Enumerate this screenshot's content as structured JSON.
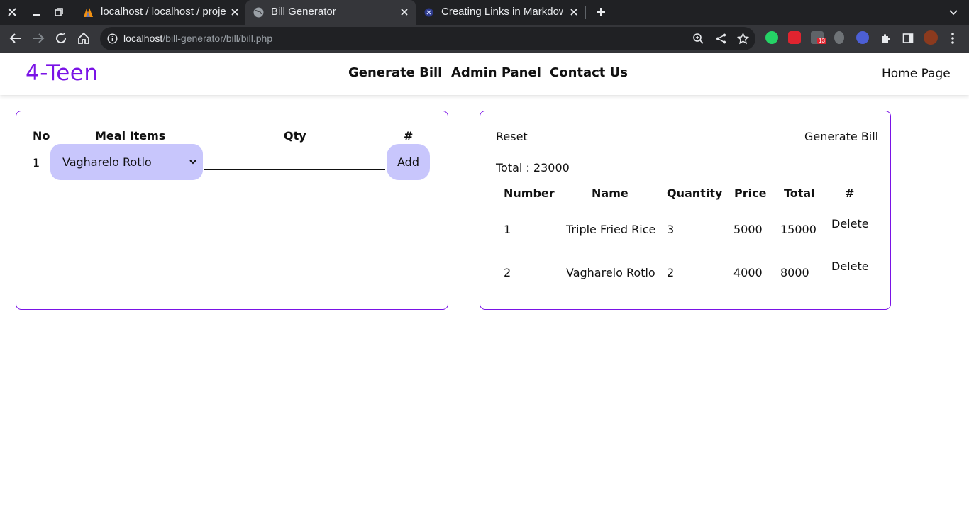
{
  "browser": {
    "tabs": [
      {
        "title": "localhost / localhost / proje",
        "active": false
      },
      {
        "title": "Bill Generator",
        "active": true
      },
      {
        "title": "Creating Links in Markdown",
        "active": false
      }
    ],
    "url": {
      "host": "localhost",
      "path": "/bill-generator/bill/bill.php"
    },
    "extension_badge": "13"
  },
  "nav": {
    "brand": "4-Teen",
    "links": [
      "Generate Bill",
      "Admin Panel",
      "Contact Us"
    ],
    "home": "Home Page"
  },
  "order_form": {
    "headers": {
      "no": "No",
      "meal": "Meal Items",
      "qty": "Qty",
      "hash": "#"
    },
    "row": {
      "no": "1",
      "selected_meal": "Vagharelo Rotlo",
      "qty_value": ""
    },
    "add_label": "Add"
  },
  "bill": {
    "reset_label": "Reset",
    "generate_label": "Generate Bill",
    "total_text": "Total : 23000",
    "headers": [
      "Number",
      "Name",
      "Quantity",
      "Price",
      "Total",
      "#"
    ],
    "rows": [
      {
        "number": "1",
        "name": "Triple Fried Rice",
        "quantity": "3",
        "price": "5000",
        "total": "15000",
        "action": "Delete"
      },
      {
        "number": "2",
        "name": "Vagharelo Rotlo",
        "quantity": "2",
        "price": "4000",
        "total": "8000",
        "action": "Delete"
      }
    ]
  },
  "colors": {
    "accent": "#7a13e6",
    "button_bg": "#c8c6fc",
    "chrome_dark": "#202124",
    "chrome_toolbar": "#35363a"
  }
}
